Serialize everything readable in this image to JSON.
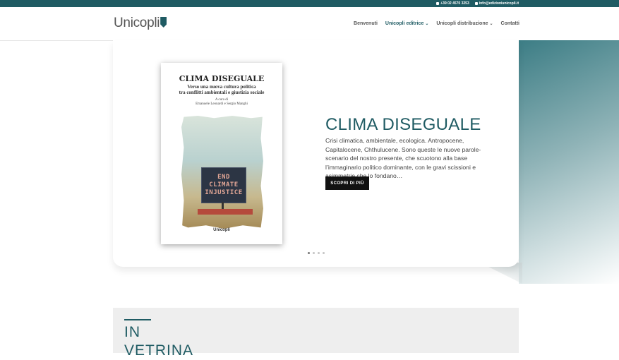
{
  "topbar": {
    "phone": "+39 02 4570 3253",
    "email": "info@edizioniunicopli.it",
    "phone_icon": "phone-icon",
    "email_icon": "envelope-icon"
  },
  "header": {
    "logo": "Unicopli",
    "nav": [
      {
        "label": "Benvenuti"
      },
      {
        "label": "Unicopli editrice"
      },
      {
        "label": "Unicopli distribuzione"
      },
      {
        "label": "Contatti"
      }
    ]
  },
  "hero": {
    "book": {
      "title": "CLIMA DISEGUALE",
      "subtitle_line1": "Verso una nuova cultura politica",
      "subtitle_line2": "tra conflitti ambientali e giustizia sociale",
      "editors_line1": "A cura di",
      "editors_line2": "Emanuele Leonardi e Sergio Manghi",
      "sign_line1": "END",
      "sign_line2": "CLIMATE",
      "sign_line3": "INJUSTICE",
      "publisher": "Unicopli"
    },
    "title": "CLIMA DISEGUALE",
    "description": "Crisi climatica, ambientale, ecologica. Antropocene, Capitalocene, Chthulucene. Sono queste le nuove parole-scenario del nostro presente, che scuotono alla base l’immaginario politico dominante, con le gravi scissioni e asimmetrie che lo fondano…",
    "button": "SCOPRI DI PIÙ",
    "slides_active": 1,
    "slides_total": 4
  },
  "vetrina": {
    "title_line1": "IN",
    "title_line2": "VETRINA"
  },
  "colors": {
    "accent": "#1f5b63",
    "button": "#111111"
  }
}
